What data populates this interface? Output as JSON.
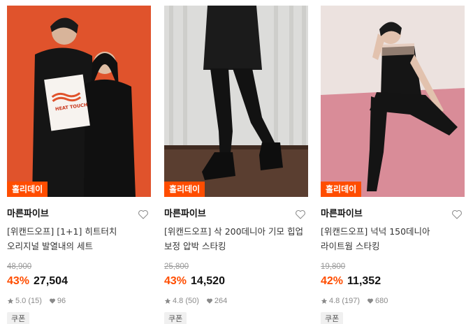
{
  "products": [
    {
      "badge": "홀리데이",
      "brand": "마른파이브",
      "title": "[위캔드오프] [1+1] 히트터치 오리지널 발열내의 세트",
      "original_price": "48,900",
      "discount": "43%",
      "price": "27,504",
      "rating": "5.0 (15)",
      "likes": "96",
      "coupon": "쿠폰",
      "product_print": "HEAT TOUCH",
      "image": {
        "bg": "#e0532c",
        "subject": "couple in black thermal underwear holding a box"
      }
    },
    {
      "badge": "홀리데이",
      "brand": "마른파이브",
      "title": "[위캔드오프] 삭 200데니아 기모 힙업 보정 압박 스타킹",
      "original_price": "25,800",
      "discount": "43%",
      "price": "14,520",
      "rating": "4.8 (50)",
      "likes": "264",
      "coupon": "쿠폰",
      "image": {
        "bg": "#d9d9d7",
        "subject": "legs in black tights and combat boots"
      }
    },
    {
      "badge": "홀리데이",
      "brand": "마른파이브",
      "title": "[위캔드오프] 넉넉 150데니아 라이트웜 스타킹",
      "original_price": "19,800",
      "discount": "42%",
      "price": "11,352",
      "rating": "4.8 (197)",
      "likes": "680",
      "coupon": "쿠폰",
      "image": {
        "bg": "#e8d6d2",
        "subject": "woman in black tights sitting on pink rug"
      }
    }
  ],
  "colors": {
    "accent": "#ff4d00",
    "muted": "#9a9a9a",
    "coupon_bg": "#f0f0f0"
  },
  "icons": {
    "like": "heart-outline-icon",
    "rating": "star-icon",
    "likes": "heart-filled-icon"
  }
}
